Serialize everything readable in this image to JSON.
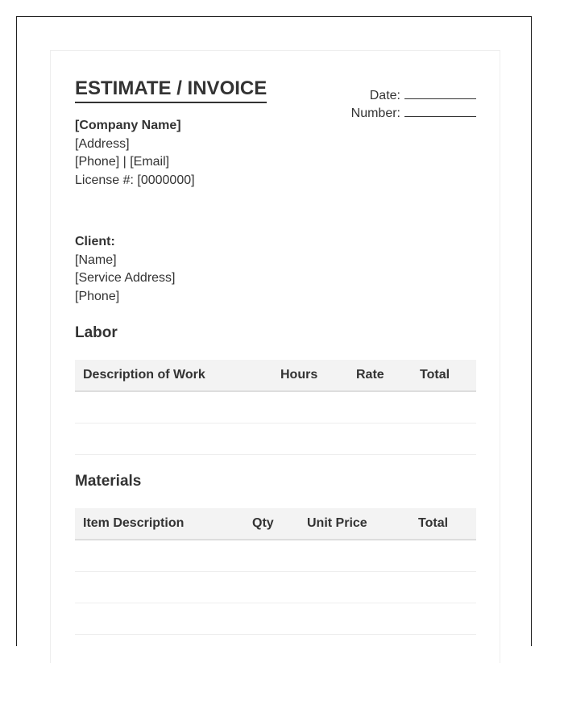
{
  "document": {
    "title": "ESTIMATE / INVOICE",
    "date_label": "Date:",
    "number_label": "Number:"
  },
  "company": {
    "name": "[Company Name]",
    "address": "[Address]",
    "contact": "[Phone] | [Email]",
    "license": "License #: [0000000]"
  },
  "client": {
    "heading": "Client:",
    "name": "[Name]",
    "service_address": "[Service Address]",
    "phone": "[Phone]"
  },
  "labor": {
    "heading": "Labor",
    "columns": [
      "Description of Work",
      "Hours",
      "Rate",
      "Total"
    ],
    "rows": [
      [
        "",
        "",
        "",
        ""
      ],
      [
        "",
        "",
        "",
        ""
      ]
    ]
  },
  "materials": {
    "heading": "Materials",
    "columns": [
      "Item Description",
      "Qty",
      "Unit Price",
      "Total"
    ],
    "rows": [
      [
        "",
        "",
        "",
        ""
      ],
      [
        "",
        "",
        "",
        ""
      ],
      [
        "",
        "",
        "",
        ""
      ]
    ]
  }
}
